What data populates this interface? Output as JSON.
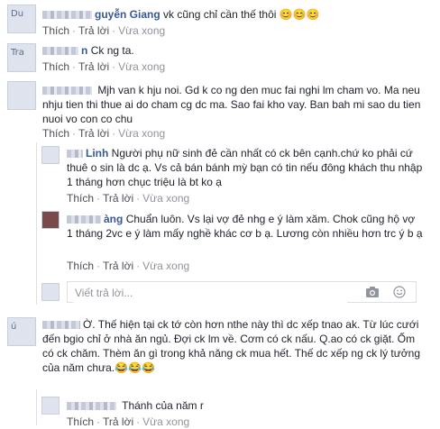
{
  "meta_labels": {
    "like": "Thích",
    "reply": "Trả lời",
    "time": "Vừa xong",
    "sep": "·"
  },
  "comments": [
    {
      "avatar_alt": "Du",
      "name": "guyễn Giang",
      "text": "vk cũng chỉ cần thế thôi 😊😊😊",
      "meta": "Vừa xong"
    },
    {
      "avatar_alt": "Tra",
      "name": "n",
      "text": "Ck ng ta."
    },
    {
      "avatar_alt": "",
      "name": "",
      "text": "Mjh van k hju noi. Gd k co ng den muc fai nghi lm cham vo. Ma neu nhju tien thi thue ai do cham cg dc ma. Sao fai kho vay. Ban bah mi sao du tien nuoi vo con co chu"
    },
    {
      "avatar_alt": "",
      "name": "Linh",
      "text": "Người phụ nữ sinh đẻ cần nhất có ck bên cạnh.chứ ko phải cứ thuê o sin là dc ạ. Vs cả bán bánh mỳ bạn có tin nếu đông khách thu nhập 1 tháng hơn chục triệu là bt ko ạ"
    },
    {
      "avatar_alt": "",
      "name": "àng",
      "text": "Chuẩn luôn. Vs lại vợ đẻ nhg e ý làm xăm. Chok cũng hộ vợ 1 tháng 2vc e ý làm mấy nghề khác cơ b ạ. Lương còn nhiều hơn trc ý b ạ"
    },
    {
      "avatar_alt": "ú",
      "name": "",
      "text": "Ờ. Thế hiện tại ck tớ còn hơn nthe này thì dc xếp tnao ak. Từ lúc cưới đến bgio chỉ ở nhà ăn ngủ. Đợi ck lm về. Cơm có ck nấu. Q.ao có ck giặt. Ốm có ck chăm. Thèm ăn gì trong khả năng ck mua hết. Thế dc xếp ng ck lý tưởng của năm chưa.😂😂😂"
    },
    {
      "avatar_alt": "",
      "name": "",
      "text": "Thánh của năm r"
    }
  ],
  "reply_input": {
    "placeholder": "Viết trả lời..."
  }
}
